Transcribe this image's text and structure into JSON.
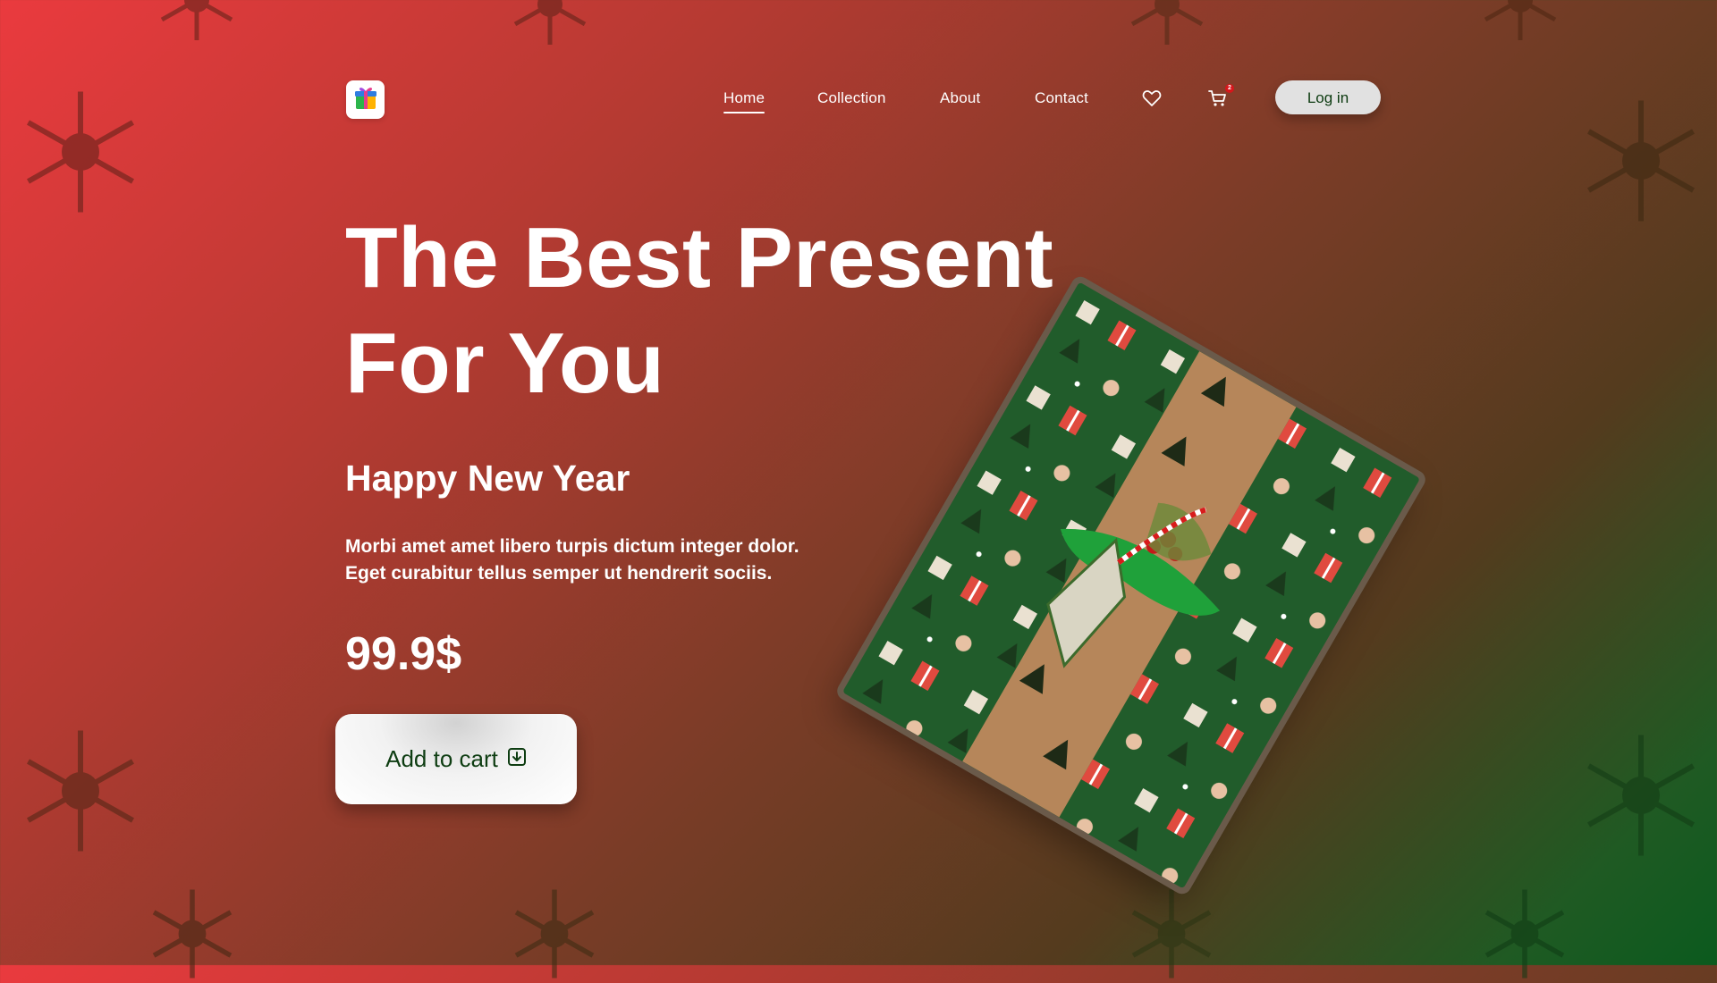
{
  "brand": {
    "logo_icon": "gift-box-icon"
  },
  "nav": {
    "links": [
      "Home",
      "Collection",
      "About",
      "Contact"
    ],
    "active": "Home",
    "wishlist_icon": "heart-icon",
    "cart_icon": "cart-icon",
    "cart_count": "2",
    "login_label": "Log in"
  },
  "hero": {
    "title_line1": "The Best Present",
    "title_line2": "For You",
    "subtitle": "Happy New Year",
    "desc_line1": "Morbi amet amet libero turpis dictum integer dolor.",
    "desc_line2": "Eget curabitur tellus semper ut hendrerit sociis.",
    "price": "99.9$",
    "cta_label": "Add to cart",
    "cta_icon": "download-box-icon"
  },
  "product_image": {
    "icon": "christmas-gift-image"
  },
  "colors": {
    "gradient_start": "#ea3a3e",
    "gradient_end": "#0b5a1e",
    "cta_text": "#0e3d12",
    "badge": "#d7161b"
  }
}
